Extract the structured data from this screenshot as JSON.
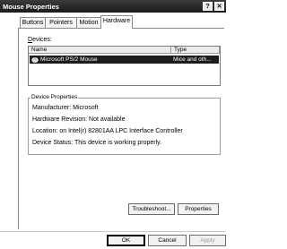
{
  "window": {
    "title": "Mouse Properties",
    "help_button": "?"
  },
  "tabs": [
    {
      "label": "Buttons",
      "active": false
    },
    {
      "label": "Pointers",
      "active": false
    },
    {
      "label": "Motion",
      "active": false
    },
    {
      "label": "Hardware",
      "active": true
    }
  ],
  "devices": {
    "label": "Devices:",
    "columns": [
      "Name",
      "Type"
    ],
    "rows": [
      {
        "name": "Microsoft PS/2 Mouse",
        "type": "Mice and oth...",
        "selected": true,
        "icon": "mouse-icon"
      }
    ]
  },
  "properties": {
    "group_label": "Device Properties",
    "manufacturer": "Manufacturer: Microsoft",
    "hardware_revision": "Hardware Revision: Not available",
    "location": "Location: on Intel(r) 82801AA LPC Interface Controller",
    "status": "Device Status: This device is working properly."
  },
  "buttons": {
    "troubleshoot": "Troubleshoot...",
    "properties": "Properties",
    "ok": "OK",
    "cancel": "Cancel",
    "apply": "Apply"
  }
}
